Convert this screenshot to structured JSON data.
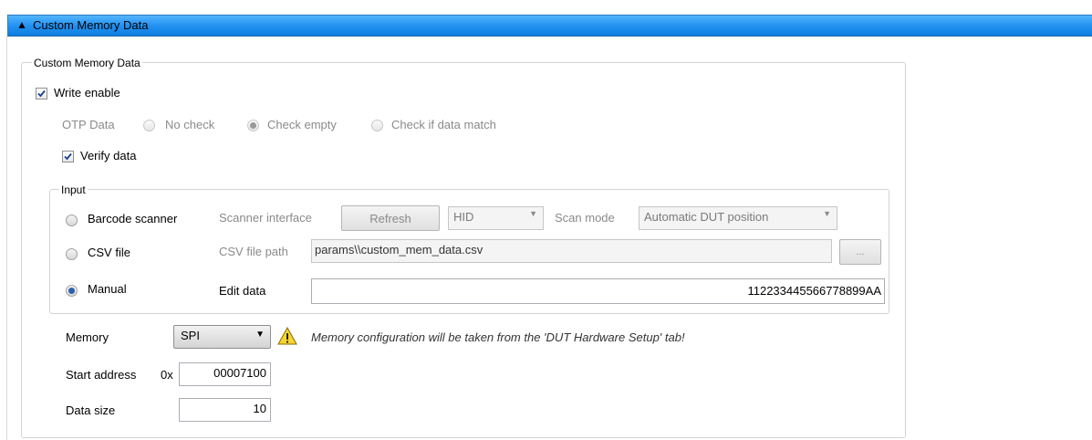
{
  "header": {
    "arrow": "▲",
    "title": "Custom Memory Data"
  },
  "group": {
    "legend": "Custom Memory Data",
    "write_enable": {
      "label": "Write enable",
      "checked": true
    },
    "otp": {
      "label": "OTP Data",
      "options": [
        "No check",
        "Check empty",
        "Check if data match"
      ],
      "selected": "Check empty"
    },
    "verify": {
      "label": "Verify data",
      "checked": true
    },
    "input": {
      "legend": "Input",
      "barcode": {
        "label": "Barcode scanner",
        "interface_label": "Scanner interface",
        "refresh_label": "Refresh",
        "interface_value": "HID",
        "scan_mode_label": "Scan mode",
        "scan_mode_value": "Automatic DUT position"
      },
      "csv": {
        "label": "CSV file",
        "path_label": "CSV file path",
        "path_value": "params\\\\custom_mem_data.csv",
        "browse_label": "..."
      },
      "manual": {
        "label": "Manual",
        "edit_label": "Edit data",
        "edit_value": "112233445566778899AA",
        "selected": true
      }
    },
    "memory": {
      "label": "Memory",
      "value": "SPI",
      "warning": "Memory configuration will be taken from the 'DUT Hardware Setup' tab!"
    },
    "start_address": {
      "label": "Start address",
      "prefix": "0x",
      "value": "00007100"
    },
    "data_size": {
      "label": "Data size",
      "value": "10"
    }
  }
}
